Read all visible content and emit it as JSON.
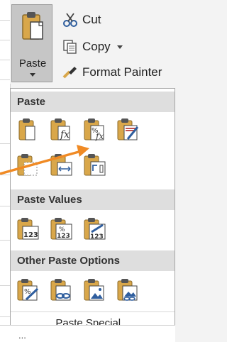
{
  "ribbon": {
    "paste_label": "Paste",
    "cut_label": "Cut",
    "copy_label": "Copy",
    "format_painter_label": "Format Painter"
  },
  "menu": {
    "sections": [
      {
        "title": "Paste",
        "icons": [
          "paste-icon",
          "paste-formulas-icon",
          "paste-formulas-number-format-icon",
          "keep-source-formatting-icon",
          "no-borders-icon",
          "keep-column-widths-icon",
          "transpose-icon"
        ]
      },
      {
        "title": "Paste Values",
        "icons": [
          "values-icon",
          "values-number-format-icon",
          "values-source-formatting-icon"
        ]
      },
      {
        "title": "Other Paste Options",
        "icons": [
          "formatting-icon",
          "paste-link-icon",
          "picture-icon",
          "linked-picture-icon"
        ]
      }
    ],
    "special_prefix": "Paste ",
    "special_underlined": "S",
    "special_suffix": "pecial..."
  },
  "bottom_partial": "...",
  "colors": {
    "accent_orange": "#f08a24",
    "clip_tan": "#d9a74a",
    "pressed_button": "#c6c6c6",
    "section_header": "#dedede"
  }
}
